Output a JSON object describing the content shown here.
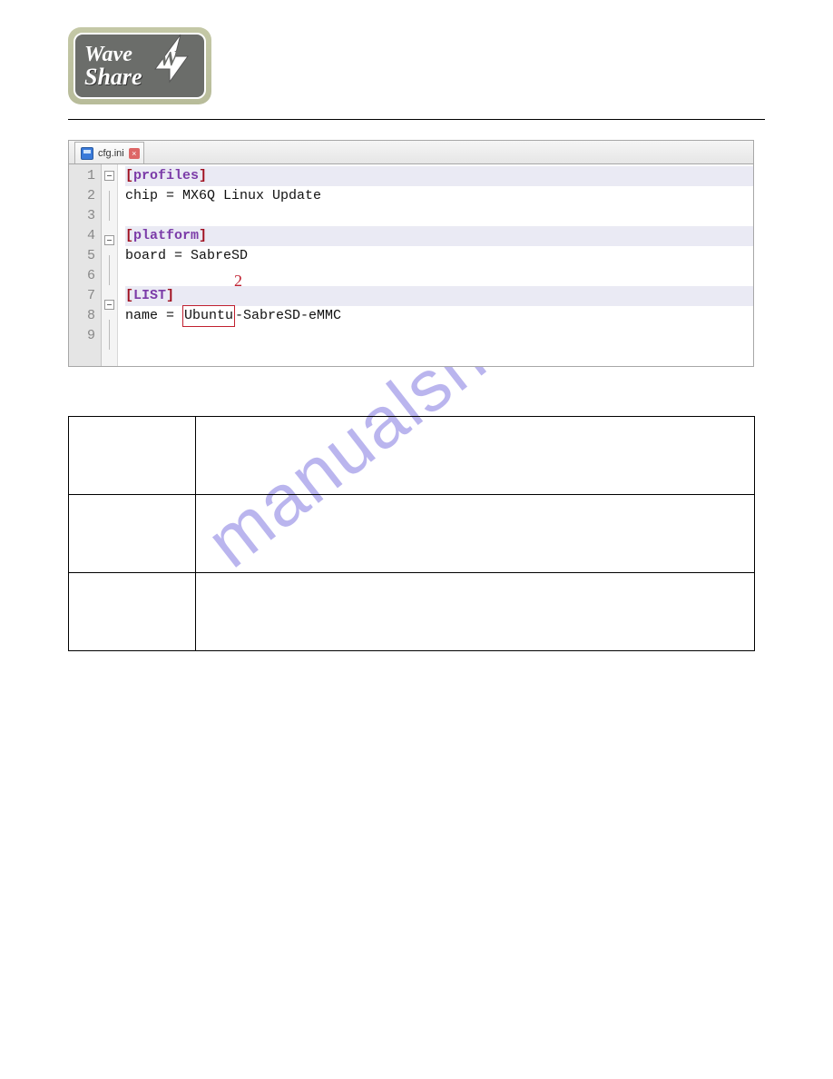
{
  "logo": {
    "top_text": "Wave",
    "bottom_text": "Share",
    "monogram": "W"
  },
  "editor": {
    "tab": {
      "filename": "cfg.ini"
    },
    "gutter": [
      "1",
      "2",
      "3",
      "4",
      "5",
      "6",
      "7",
      "8",
      "9"
    ],
    "lines": {
      "l1_section": "profiles",
      "l2": "chip = MX6Q Linux Update",
      "l4_section": "platform",
      "l5": "board = SabreSD",
      "l7_section": "LIST",
      "l8_prefix": "name = ",
      "l8_highlight": "Ubuntu",
      "l8_suffix": "-SabreSD-eMMC"
    },
    "annotation_label": "2"
  },
  "table": {
    "rows": [
      {
        "col1": "",
        "col2": ""
      },
      {
        "col1": "",
        "col2": ""
      },
      {
        "col1": "",
        "col2": ""
      }
    ]
  },
  "watermark": "manualshive.com"
}
